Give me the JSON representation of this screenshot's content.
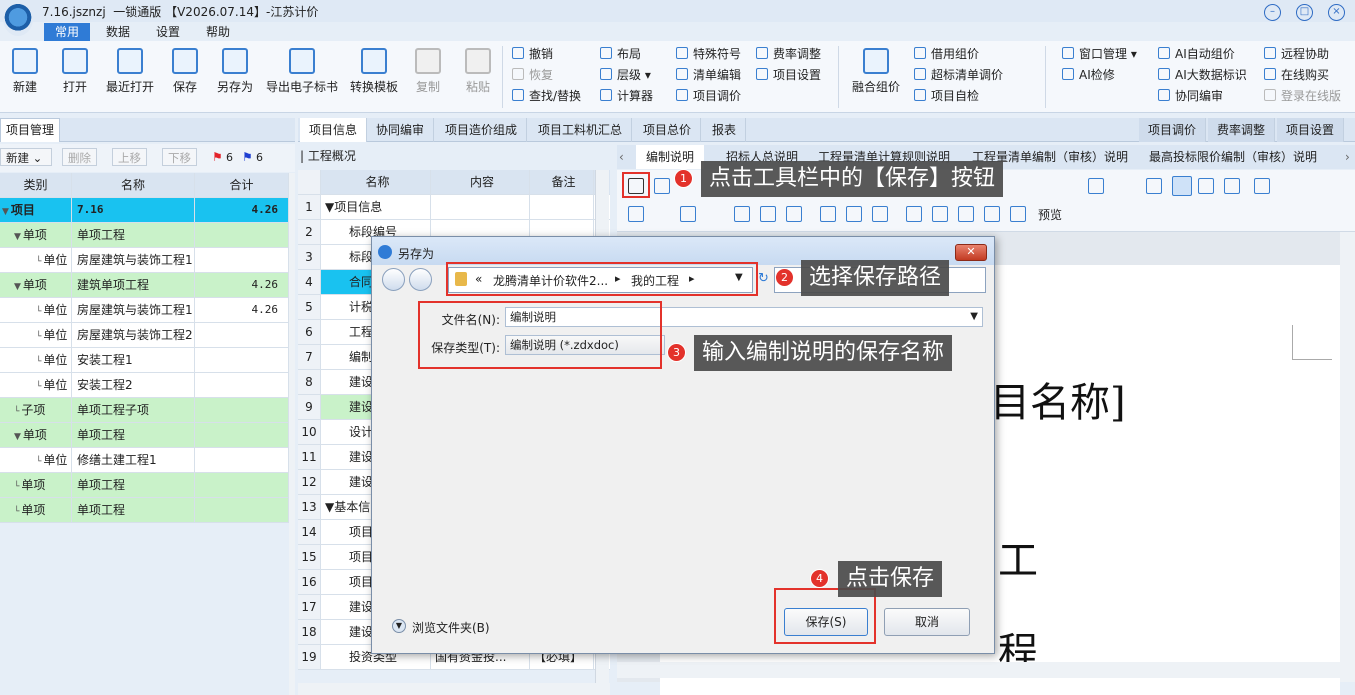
{
  "window": {
    "title": "7.16.jsznzj  一锁通版 【V2026.07.14】-江苏计价"
  },
  "menu_tabs": [
    "常用",
    "数据",
    "设置",
    "帮助"
  ],
  "ribbon": {
    "big_buttons": [
      {
        "label": "新建",
        "icon": "new-file-icon"
      },
      {
        "label": "打开",
        "icon": "folder-open-icon"
      },
      {
        "label": "最近打开",
        "icon": "recent-icon"
      },
      {
        "label": "保存",
        "icon": "save-icon"
      },
      {
        "label": "另存为",
        "icon": "save-as-icon"
      },
      {
        "label": "导出电子标书",
        "icon": "export-icon"
      },
      {
        "label": "转换模板",
        "icon": "convert-icon"
      },
      {
        "label": "复制",
        "icon": "copy-icon",
        "disabled": true
      },
      {
        "label": "粘贴",
        "icon": "paste-icon",
        "disabled": true
      }
    ],
    "group1": [
      "撤销",
      "恢复",
      "查找/替换"
    ],
    "group2": [
      "布局",
      "层级",
      "计算器"
    ],
    "group3": [
      "特殊符号",
      "清单编辑",
      "项目调价"
    ],
    "group4": [
      "费率调整",
      "项目设置"
    ],
    "merge_label": "融合组价",
    "group5": [
      "借用组价",
      "超标清单调价",
      "项目自检"
    ],
    "group6": [
      "窗口管理",
      "AI检修"
    ],
    "group7": [
      "AI自动组价",
      "AI大数据标识",
      "协同编审"
    ],
    "group8": [
      "远程协助",
      "在线购买",
      "登录在线版"
    ]
  },
  "left_panel": {
    "tab": "项目管理",
    "toolbar": {
      "new": "新建",
      "delete": "删除",
      "up": "上移",
      "down": "下移",
      "flag_red": "6",
      "flag_blue": "6"
    },
    "headers": [
      "类别",
      "名称",
      "合计"
    ],
    "rows": [
      {
        "cat": "项目",
        "name": "7.16",
        "total": "4.26",
        "level": 0
      },
      {
        "cat": "单项",
        "name": "单项工程",
        "total": "",
        "level": 1
      },
      {
        "cat": "单位",
        "name": "房屋建筑与装饰工程1",
        "total": "",
        "level": 2
      },
      {
        "cat": "单项",
        "name": "建筑单项工程",
        "total": "4.26",
        "level": 1
      },
      {
        "cat": "单位",
        "name": "房屋建筑与装饰工程1",
        "total": "4.26",
        "level": 2
      },
      {
        "cat": "单位",
        "name": "房屋建筑与装饰工程2",
        "total": "",
        "level": 2
      },
      {
        "cat": "单位",
        "name": "安装工程1",
        "total": "",
        "level": 2
      },
      {
        "cat": "单位",
        "name": "安装工程2",
        "total": "",
        "level": 2
      },
      {
        "cat": "子项",
        "name": "单项工程子项",
        "total": "",
        "level": 1
      },
      {
        "cat": "单项",
        "name": "单项工程",
        "total": "",
        "level": 1
      },
      {
        "cat": "单位",
        "name": "修缮土建工程1",
        "total": "",
        "level": 2
      },
      {
        "cat": "单项",
        "name": "单项工程",
        "total": "",
        "level": 1
      },
      {
        "cat": "单项",
        "name": "单项工程",
        "total": "",
        "level": 1
      }
    ]
  },
  "main_tabs": [
    "项目信息",
    "协同编审",
    "项目造价组成",
    "项目工料机汇总",
    "项目总价",
    "报表"
  ],
  "right_tabs": [
    "项目调价",
    "费率调整",
    "项目设置"
  ],
  "overview": {
    "title": "工程概况",
    "headers": [
      "名称",
      "内容",
      "备注"
    ],
    "rows": [
      {
        "n": "1",
        "name": "▼项目信息"
      },
      {
        "n": "2",
        "name": "标段编号"
      },
      {
        "n": "3",
        "name": "标段名称"
      },
      {
        "n": "4",
        "name": "合同"
      },
      {
        "n": "5",
        "name": "计税"
      },
      {
        "n": "6",
        "name": "工程"
      },
      {
        "n": "7",
        "name": "编制"
      },
      {
        "n": "8",
        "name": "建设"
      },
      {
        "n": "9",
        "name": "建设"
      },
      {
        "n": "10",
        "name": "设计"
      },
      {
        "n": "11",
        "name": "建设"
      },
      {
        "n": "12",
        "name": "建设"
      },
      {
        "n": "13",
        "name": "▼基本信"
      },
      {
        "n": "14",
        "name": "项目"
      },
      {
        "n": "15",
        "name": "项目"
      },
      {
        "n": "16",
        "name": "项目"
      },
      {
        "n": "17",
        "name": "建设"
      },
      {
        "n": "18",
        "name": "建设"
      },
      {
        "n": "19",
        "name": "投资类型",
        "content": "国有资金投...",
        "note": "【必填】"
      }
    ]
  },
  "editor": {
    "tabs": [
      "编制说明",
      "招标人总说明",
      "工程量清单计算规则说明",
      "工程量清单编制（审核）说明",
      "最高投标限价编制（审核）说明"
    ],
    "preview_label": "预览",
    "doc_title_fragment": "目名称]",
    "doc_line_1": "工",
    "doc_line_2": "程"
  },
  "dialog": {
    "title": "另存为",
    "path": [
      "«",
      "龙腾清单计价软件2...",
      "我的工程"
    ],
    "filename_label": "文件名(N):",
    "filename_value": "编制说明",
    "filetype_label": "保存类型(T):",
    "filetype_value": "编制说明 (*.zdxdoc)",
    "browse_label": "浏览文件夹(B)",
    "save_button": "保存(S)",
    "cancel_button": "取消"
  },
  "annotations": [
    {
      "n": "1",
      "text": "点击工具栏中的【保存】按钮"
    },
    {
      "n": "2",
      "text": "选择保存路径"
    },
    {
      "n": "3",
      "text": "输入编制说明的保存名称"
    },
    {
      "n": "4",
      "text": "点击保存"
    }
  ],
  "colors": {
    "accent": "#2f7bd6",
    "highlight_cyan": "#19c2f0",
    "row_green": "#c9f2c9",
    "annotation_red": "#e3322b"
  }
}
